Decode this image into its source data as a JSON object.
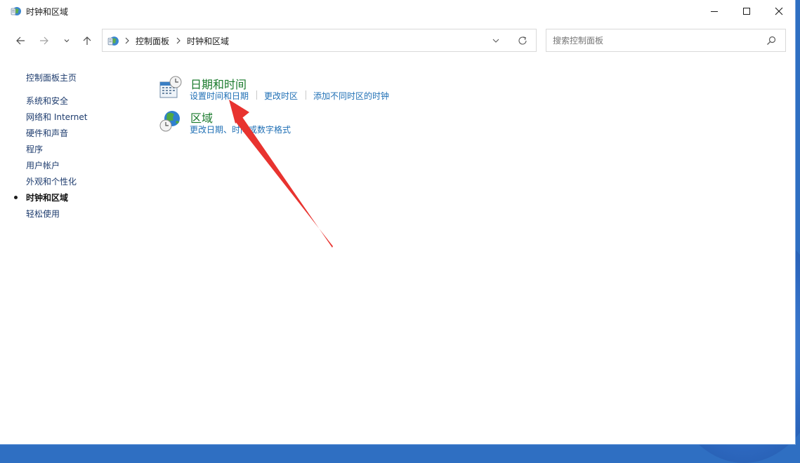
{
  "window": {
    "title": "时钟和区域"
  },
  "address": {
    "crumbs": [
      "控制面板",
      "时钟和区域"
    ]
  },
  "search": {
    "placeholder": "搜索控制面板"
  },
  "sidebar": {
    "items": [
      {
        "label": "控制面板主页",
        "active": false
      },
      {
        "label": "系统和安全",
        "active": false
      },
      {
        "label": "网络和 Internet",
        "active": false
      },
      {
        "label": "硬件和声音",
        "active": false
      },
      {
        "label": "程序",
        "active": false
      },
      {
        "label": "用户帐户",
        "active": false
      },
      {
        "label": "外观和个性化",
        "active": false
      },
      {
        "label": "时钟和区域",
        "active": true
      },
      {
        "label": "轻松使用",
        "active": false
      }
    ]
  },
  "categories": [
    {
      "title": "日期和时间",
      "icon": "calendar-clock-icon",
      "links": [
        "设置时间和日期",
        "更改时区",
        "添加不同时区的时钟"
      ]
    },
    {
      "title": "区域",
      "icon": "globe-clock-icon",
      "links": [
        "更改日期、时间或数字格式"
      ]
    }
  ],
  "annotation": {
    "type": "red-arrow",
    "color": "#e8332f"
  },
  "colors": {
    "category_title": "#1a7a2c",
    "link": "#1f6fb5",
    "desktop": "#2f6fc2"
  }
}
